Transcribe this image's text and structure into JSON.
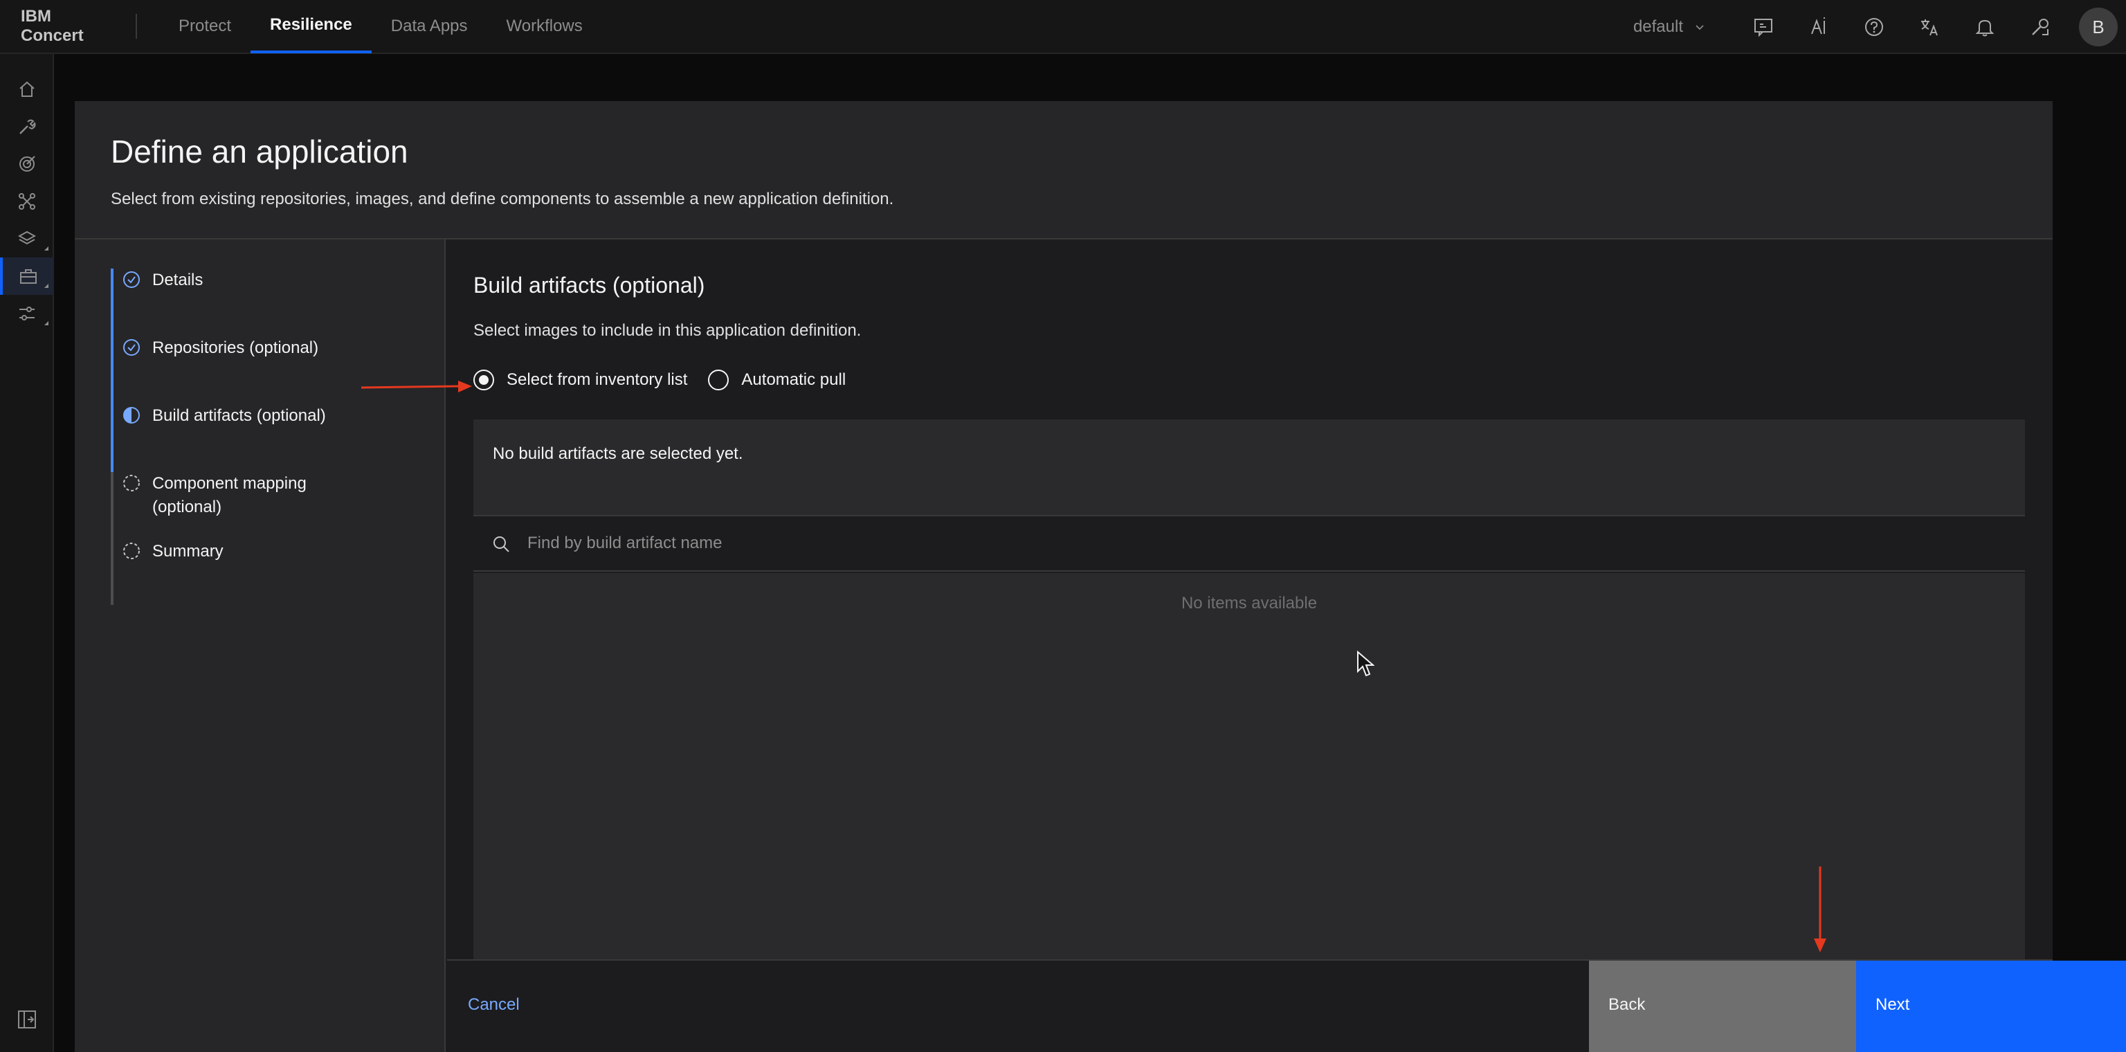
{
  "header": {
    "brand": "IBM Concert",
    "nav": [
      {
        "label": "Protect"
      },
      {
        "label": "Resilience"
      },
      {
        "label": "Data Apps"
      },
      {
        "label": "Workflows"
      }
    ],
    "tenant": "default",
    "user_initial": "B"
  },
  "modal": {
    "title": "Define an application",
    "description": "Select from existing repositories, images, and define components to assemble a new application definition."
  },
  "steps": [
    {
      "label": "Details",
      "status": "complete"
    },
    {
      "label": "Repositories (optional)",
      "status": "complete"
    },
    {
      "label": "Build artifacts (optional)",
      "status": "current"
    },
    {
      "label": "Component mapping (optional)",
      "status": "incomplete"
    },
    {
      "label": "Summary",
      "status": "incomplete"
    }
  ],
  "content": {
    "title": "Build artifacts (optional)",
    "description": "Select images to include in this application definition.",
    "radio_options": [
      {
        "label": "Select from inventory list",
        "selected": true
      },
      {
        "label": "Automatic pull",
        "selected": false
      }
    ],
    "empty_selected_text": "No build artifacts are selected yet.",
    "search_placeholder": "Find by build artifact name",
    "no_items_text": "No items available"
  },
  "footer": {
    "cancel_label": "Cancel",
    "back_label": "Back",
    "next_label": "Next"
  },
  "colors": {
    "accent": "#0f62fe",
    "progress": "#4589ff",
    "annotation": "#e5391f"
  }
}
